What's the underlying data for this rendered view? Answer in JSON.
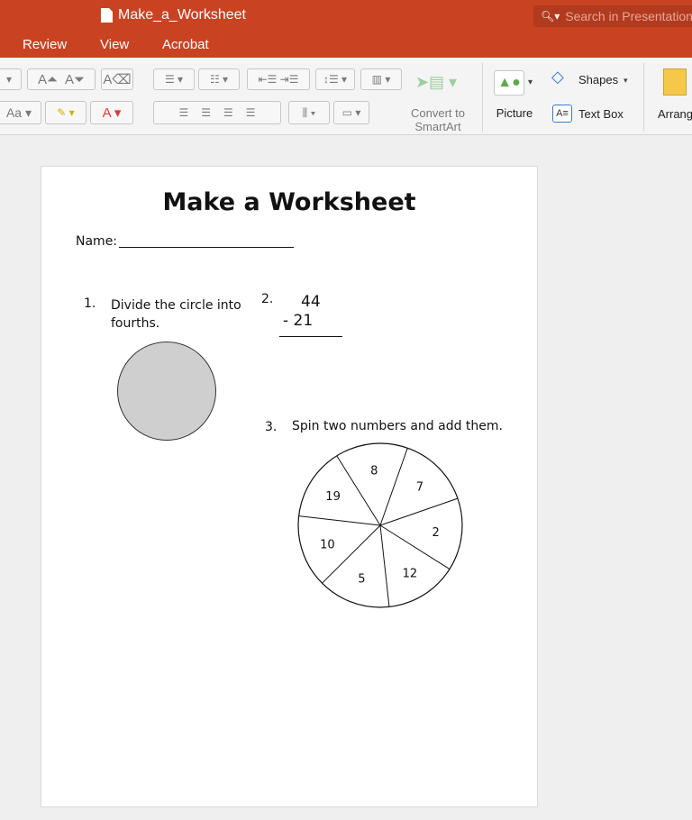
{
  "window": {
    "doc_title": "Make_a_Worksheet",
    "search_placeholder": "Search in Presentation"
  },
  "tabs": [
    {
      "label": "Review"
    },
    {
      "label": "View"
    },
    {
      "label": "Acrobat"
    }
  ],
  "ribbon": {
    "convert_label_1": "Convert to",
    "convert_label_2": "SmartArt",
    "picture_label": "Picture",
    "shapes_label": "Shapes",
    "textbox_label": "Text Box",
    "arrange_label": "Arrange"
  },
  "worksheet": {
    "title": "Make a Worksheet",
    "name_label": "Name:",
    "q1_number": "1.",
    "q1_line1": "Divide the circle into",
    "q1_line2": "fourths.",
    "q2_number": "2.",
    "q2_top": "44",
    "q2_bottom": "- 21",
    "q3_number": "3.",
    "q3_text": "Spin two numbers and add them.",
    "spinner_numbers": [
      "8",
      "7",
      "2",
      "12",
      "5",
      "10",
      "19"
    ]
  },
  "colors": {
    "accent": "#c94323",
    "circle_fill": "#cfcfcf"
  }
}
